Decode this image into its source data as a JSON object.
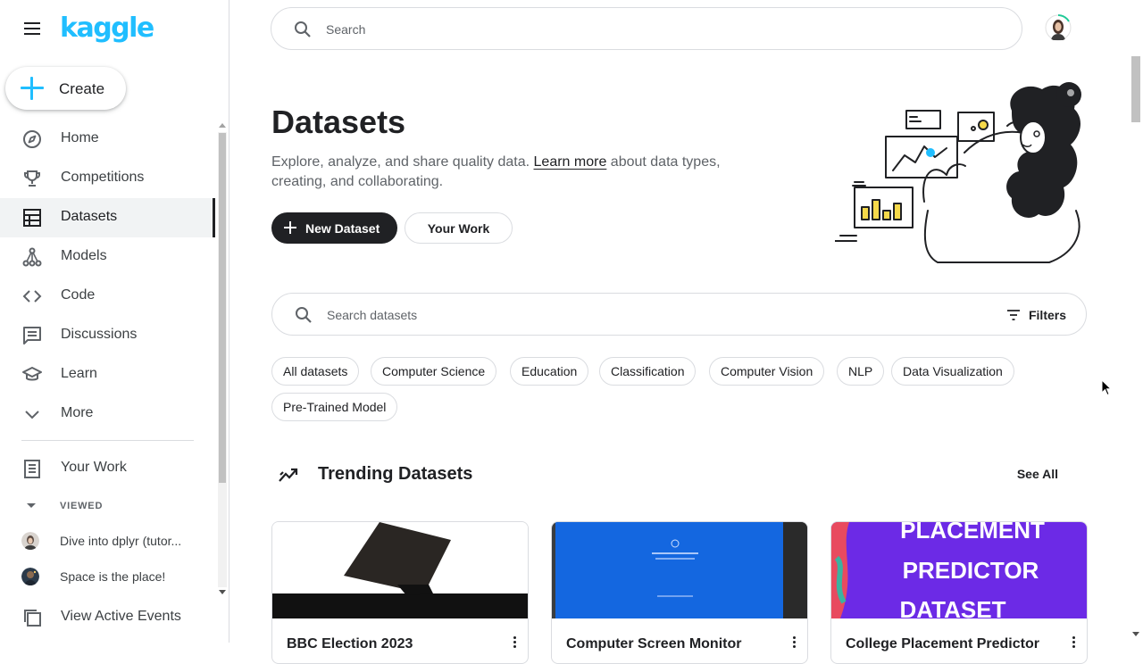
{
  "brand": {
    "logo_text": "kaggle",
    "accent": "#20beff"
  },
  "sidebar": {
    "create_label": "Create",
    "items": [
      {
        "label": "Home",
        "icon": "compass-icon"
      },
      {
        "label": "Competitions",
        "icon": "trophy-icon"
      },
      {
        "label": "Datasets",
        "icon": "table-icon",
        "active": true
      },
      {
        "label": "Models",
        "icon": "models-icon"
      },
      {
        "label": "Code",
        "icon": "code-icon"
      },
      {
        "label": "Discussions",
        "icon": "discussion-icon"
      },
      {
        "label": "Learn",
        "icon": "school-icon"
      },
      {
        "label": "More",
        "icon": "chevron-down-icon"
      }
    ],
    "your_work_label": "Your Work",
    "viewed_label": "VIEWED",
    "viewed_items": [
      {
        "label": "Dive into dplyr (tutor..."
      },
      {
        "label": "Space is the place!"
      }
    ],
    "view_events_label": "View Active Events"
  },
  "header": {
    "search_placeholder": "Search"
  },
  "page": {
    "title": "Datasets",
    "desc_before": "Explore, analyze, and share quality data. ",
    "learn_more": "Learn more",
    "desc_after": " about data types, creating, and collaborating.",
    "new_dataset_label": "New Dataset",
    "your_work_label": "Your Work"
  },
  "dataset_search": {
    "placeholder": "Search datasets",
    "filters_label": "Filters"
  },
  "chips": [
    "All datasets",
    "Computer Science",
    "Education",
    "Classification",
    "Computer Vision",
    "NLP",
    "Data Visualization",
    "Pre-Trained Model"
  ],
  "trending": {
    "title": "Trending Datasets",
    "see_all": "See All",
    "cards": [
      {
        "title": "BBC Election 2023"
      },
      {
        "title": "Computer Screen Monitor"
      },
      {
        "title": "College Placement Predictor"
      }
    ],
    "card3_thumb_lines": [
      "PLACEMENT",
      "PREDICTOR",
      "DATASET"
    ]
  }
}
